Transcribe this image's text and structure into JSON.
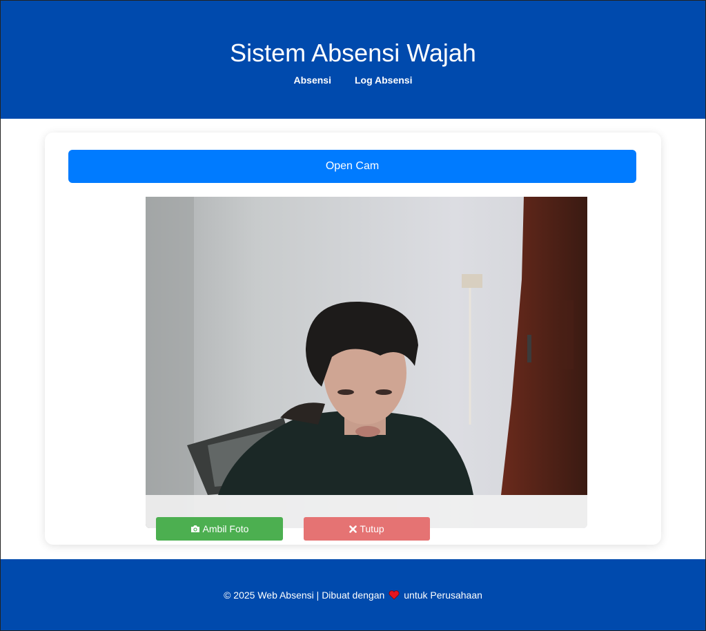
{
  "header": {
    "title": "Sistem Absensi Wajah",
    "nav": [
      "Absensi",
      "Log Absensi"
    ]
  },
  "main": {
    "open_cam_label": "Open Cam",
    "camera": {
      "capture_label": "Ambil Foto",
      "capture_icon": "camera-icon",
      "close_label": "Tutup",
      "close_icon": "close-icon"
    }
  },
  "footer": {
    "text_before": "© 2025 Web Absensi | Dibuat dengan",
    "heart_icon": "heart-icon",
    "text_after": "untuk Perusahaan"
  },
  "colors": {
    "header_bg": "#004aad",
    "primary_button": "#007bff",
    "capture_button": "#4caf50",
    "close_button": "#e57373"
  }
}
